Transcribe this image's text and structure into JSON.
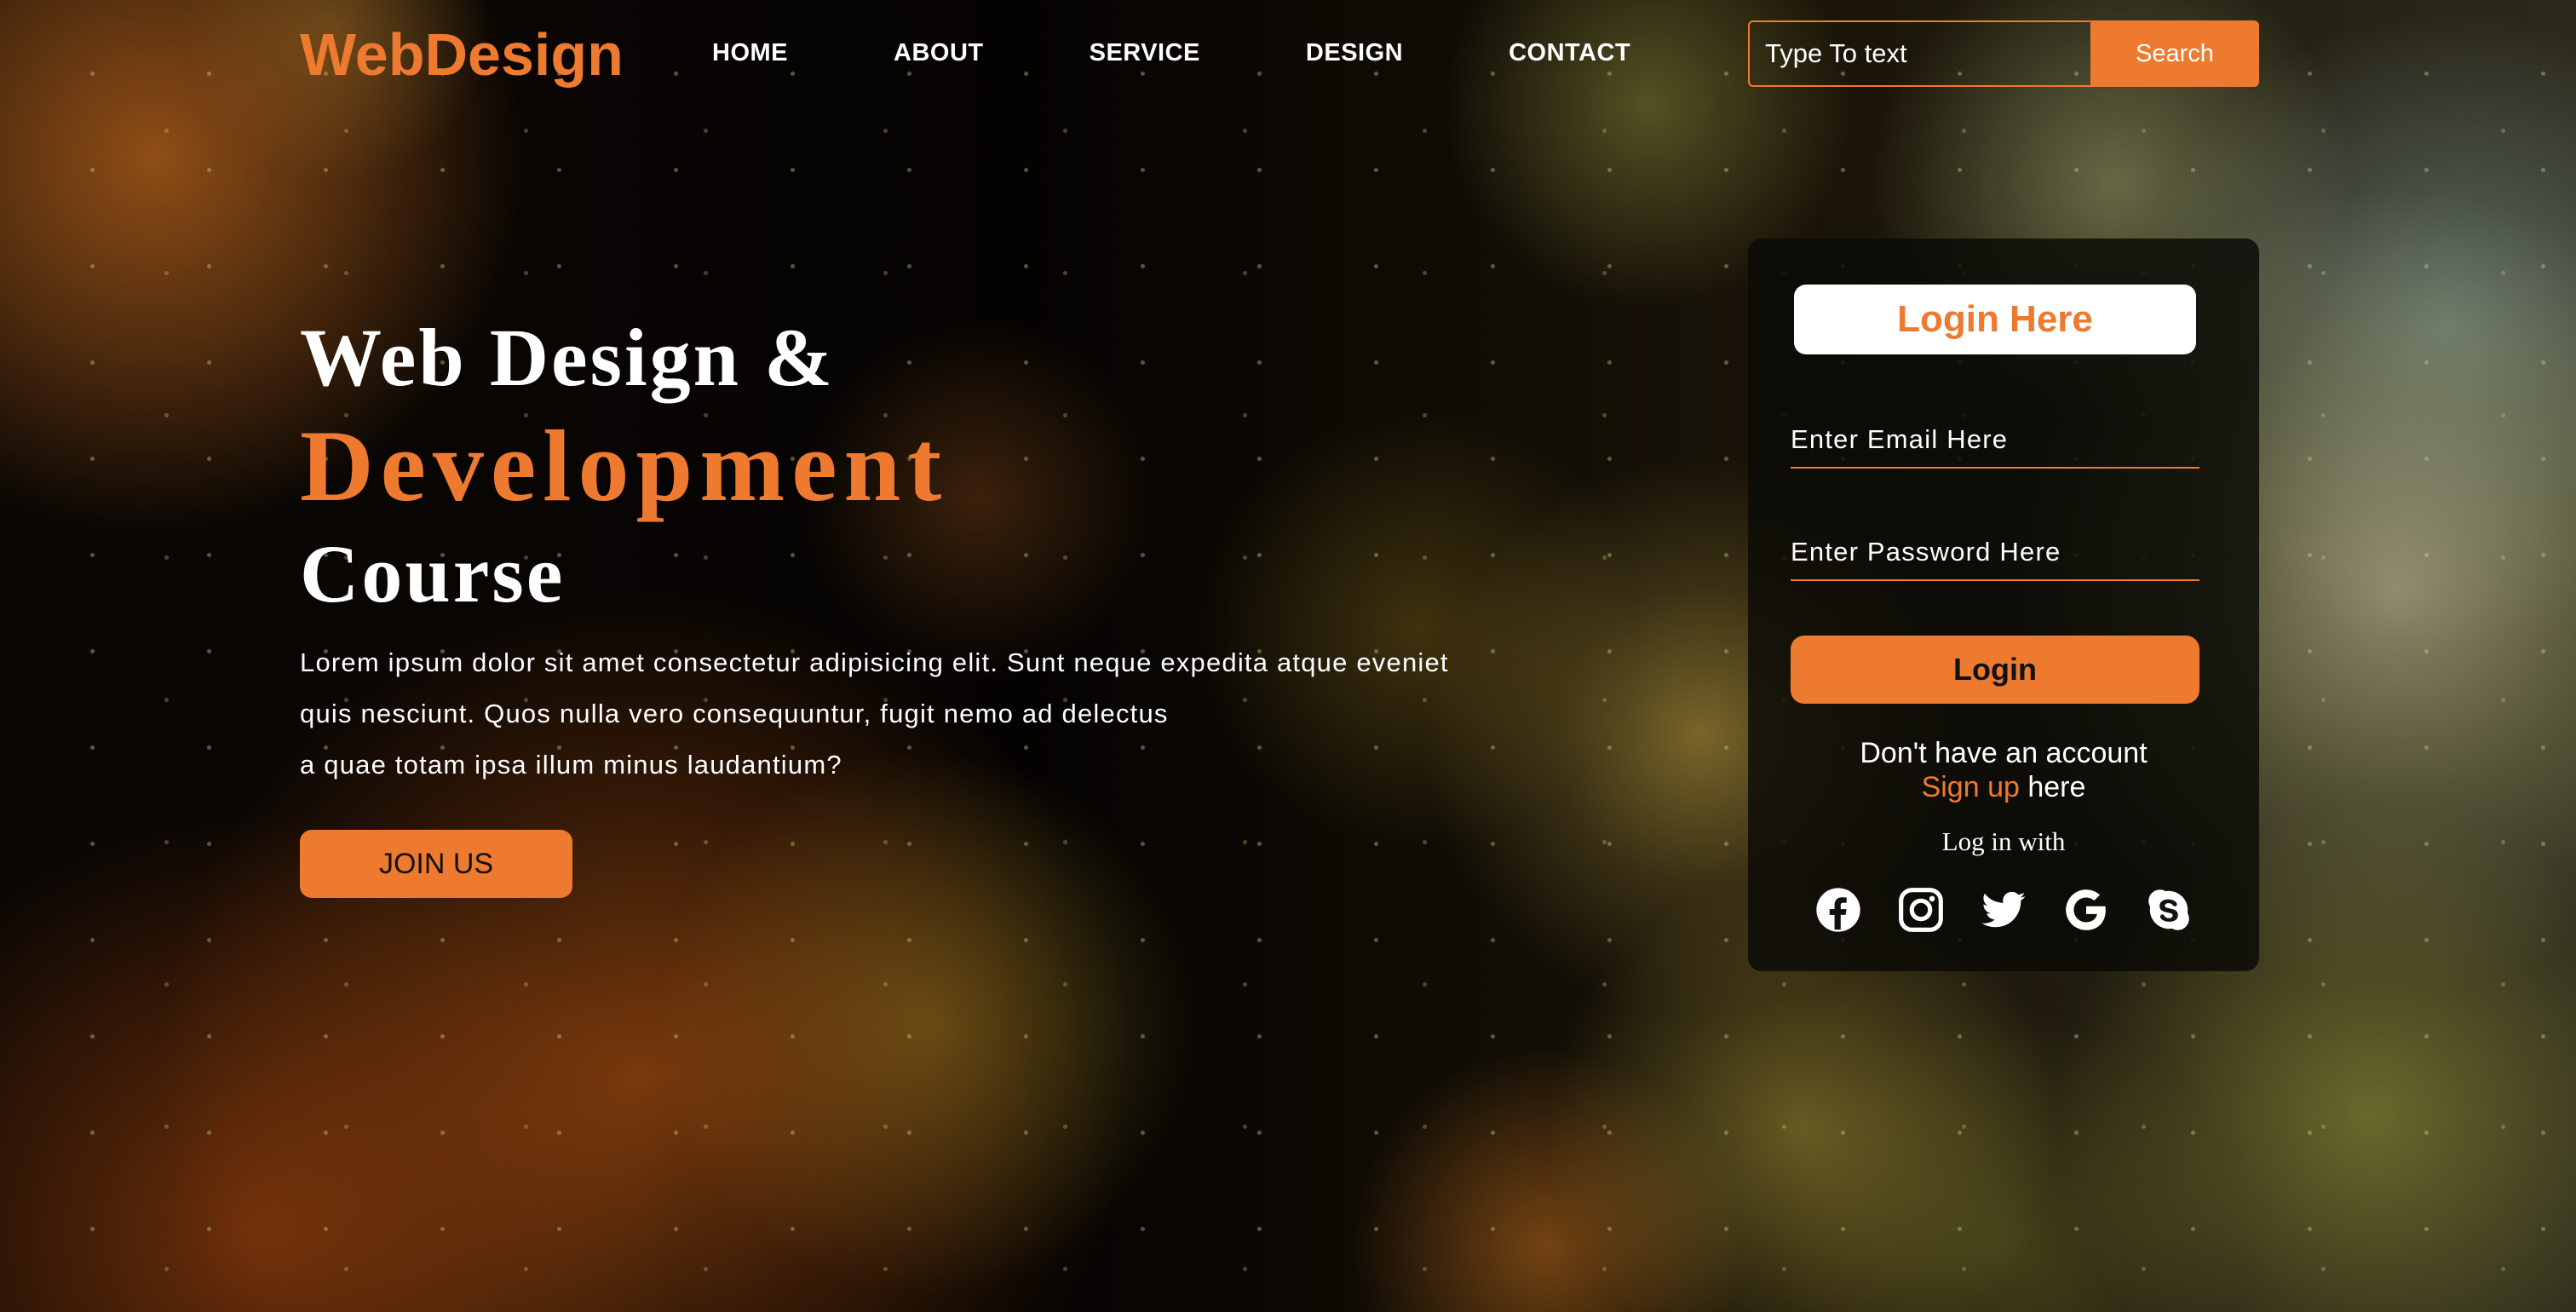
{
  "header": {
    "logo": "WebDesign",
    "nav": [
      {
        "label": "HOME"
      },
      {
        "label": "ABOUT"
      },
      {
        "label": "SERVICE"
      },
      {
        "label": "DESIGN"
      },
      {
        "label": "CONTACT"
      }
    ],
    "search": {
      "placeholder": "Type To text",
      "button_label": "Search"
    }
  },
  "hero": {
    "line1": "Web Design &",
    "line2": "Development",
    "line3": "Course",
    "paragraph": [
      "Lorem ipsum dolor sit amet consectetur adipisicing elit. Sunt neque expedita atque eveniet",
      "quis nesciunt. Quos nulla vero consequuntur, fugit nemo ad delectus",
      "a quae totam ipsa illum minus laudantium?"
    ],
    "cta_label": "JOIN US"
  },
  "login": {
    "title": "Login Here",
    "email_placeholder": "Enter Email Here",
    "password_placeholder": "Enter Password Here",
    "button_label": "Login",
    "no_account_text": "Don't have an account",
    "signup_link": "Sign up",
    "signup_suffix": " here",
    "login_with": "Log in with",
    "socials": [
      "facebook-icon",
      "instagram-icon",
      "twitter-icon",
      "google-icon",
      "skype-icon"
    ]
  },
  "colors": {
    "accent": "#ee7a30",
    "text": "#ffffff",
    "panel": "#0a0a06"
  }
}
